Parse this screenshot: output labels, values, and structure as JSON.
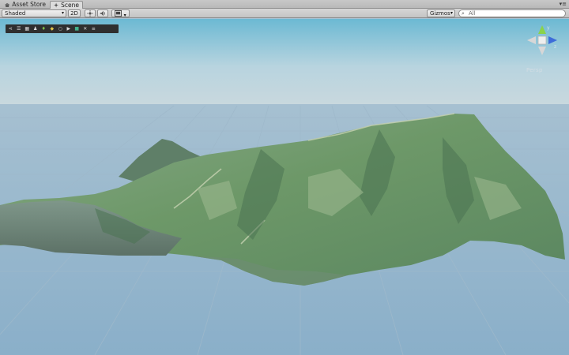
{
  "tabs": [
    {
      "label": "Asset Store",
      "icon": "asset-store-icon",
      "active": false
    },
    {
      "label": "Scene",
      "icon": "scene-icon",
      "active": true
    }
  ],
  "tab_menu_icon": "tab-menu-icon",
  "toolbar": {
    "draw_mode": "Shaded",
    "mode_2d": "2D",
    "lighting_icon": "sun-icon",
    "audio_icon": "speaker-icon",
    "effects_icon": "image-icon",
    "gizmos_label": "Gizmos",
    "search_placeholder": "All",
    "search_icon": "search-icon"
  },
  "tool_panel": {
    "icons": [
      "share-icon",
      "layers-icon",
      "grid-icon",
      "person-icon",
      "leaf-icon",
      "tag-icon",
      "circle-icon",
      "camera-icon",
      "square-icon",
      "close-icon",
      "menu-icon"
    ]
  },
  "orientation_gizmo": {
    "projection_label": "Persp",
    "axes": {
      "y": "y",
      "z": "z"
    },
    "colors": {
      "x": "#d7d7d7",
      "y": "#8bd34a",
      "z": "#3d6cd9"
    }
  },
  "scene": {
    "sky_color": "#7cc2d9",
    "ground_color": "#8fb2cc",
    "terrain_colors": [
      "#6f9a6c",
      "#8aac7e",
      "#4f7a55",
      "#b9c7a7"
    ]
  }
}
